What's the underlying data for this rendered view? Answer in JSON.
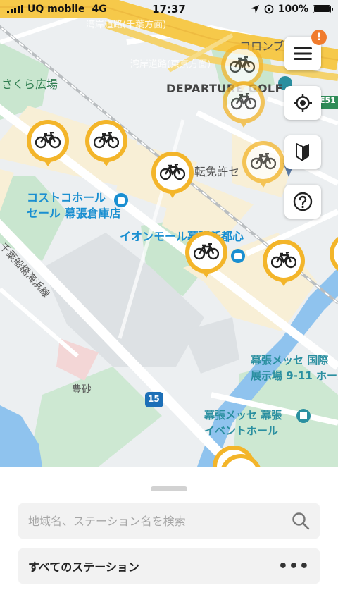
{
  "status": {
    "carrier": "UQ mobile",
    "network": "4G",
    "time": "17:37",
    "battery": "100%",
    "battery_fraction": 1.0
  },
  "map": {
    "labels": {
      "sakura": "さくら広場",
      "departure": "DEPARTURE GOLF",
      "costco": "コストコホール\nセール 幕張倉庫店",
      "unten": "転免許セ",
      "aeon": "イオンモール幕張新都心",
      "messe1": "幕張メッセ 国際\n展示場 9-11 ホール",
      "messe2": "幕張メッセ 幕張\nイベントホール",
      "toyosuna": "豊砂",
      "route15": "15",
      "e51": "E51",
      "chiba_line": "千葉船橋海浜線",
      "hw_top": "湾岸道路(千葉方面)",
      "hw_mid": "湾岸道路(東京方面)",
      "corone": "コロンブ"
    }
  },
  "controls": {
    "menu_badge": "!"
  },
  "sheet": {
    "search_placeholder": "地域名、ステーション名を検索",
    "all_stations": "すべてのステーション",
    "more": "•••"
  }
}
